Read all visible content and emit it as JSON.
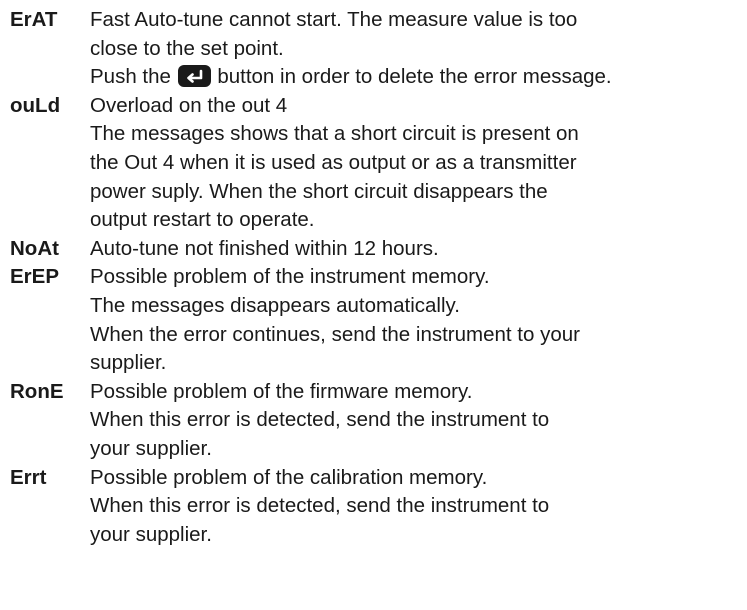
{
  "errors": [
    {
      "code": "ErAT",
      "lines": [
        "Fast Auto-tune cannot start. The  measure value is too",
        "close to the set point."
      ],
      "push_line": {
        "before": "Push the",
        "icon": "enter-key-icon",
        "after": "button in order to delete the error message."
      }
    },
    {
      "code": "ouLd",
      "lines": [
        "Overload on the out 4",
        "The messages shows that a short circuit is present on",
        "the Out 4 when it is used as output or as a transmitter",
        "power suply.  When the short circuit disappears the",
        "output restart to operate."
      ]
    },
    {
      "code": "NoAt",
      "lines": [
        "Auto-tune not finished within 12 hours."
      ]
    },
    {
      "code": "ErEP",
      "lines": [
        "Possible problem of the instrument memory.",
        "The messages disappears automatically.",
        "When the error continues, send the instrument to your",
        "supplier."
      ]
    },
    {
      "code": "RonE",
      "lines": [
        "Possible problem of the firmware memory.",
        "When this error is detected, send the instrument to",
        "your supplier."
      ]
    },
    {
      "code": "Errt",
      "lines": [
        "Possible problem of the calibration memory.",
        "When this error is detected, send the instrument to",
        "your supplier."
      ]
    }
  ]
}
